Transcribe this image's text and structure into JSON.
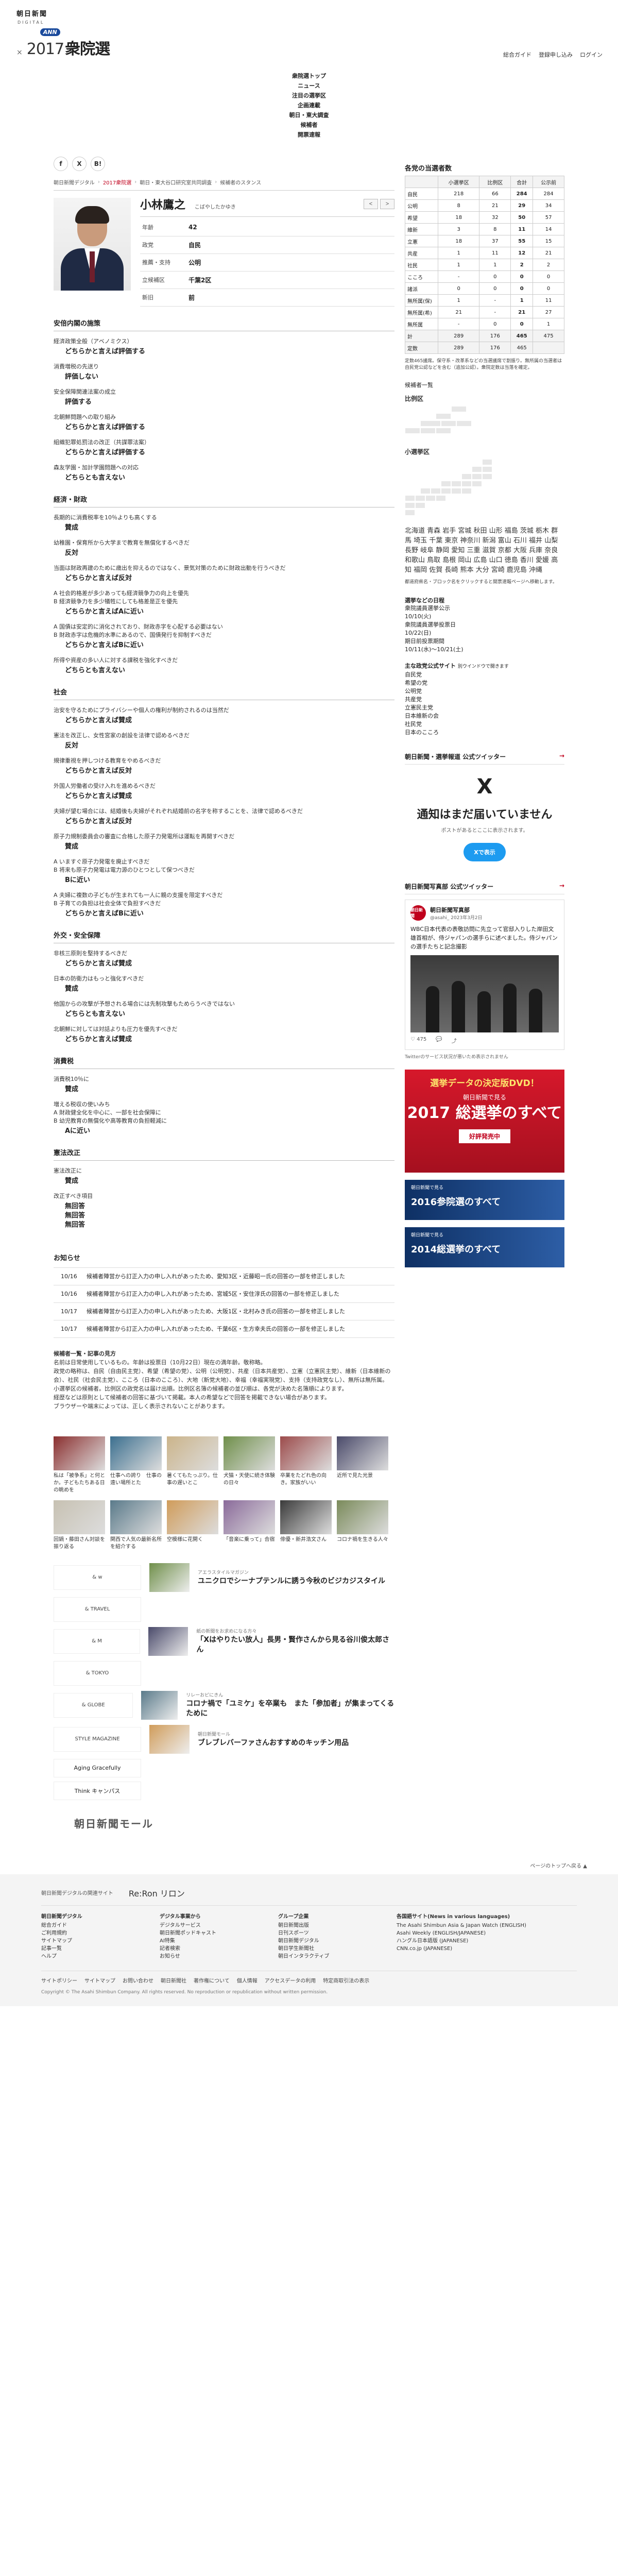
{
  "header": {
    "brand": "朝日新聞",
    "brand_sub": "DIGITAL",
    "cross": "×",
    "ann": "ANN",
    "election_year": "2017",
    "election_name": "衆院選",
    "util": [
      "総合ガイド",
      "登録申し込み",
      "ログイン"
    ]
  },
  "nav": [
    "衆院選トップ",
    "ニュース",
    "注目の選挙区",
    "企画連載",
    "朝日・東大調査",
    "候補者",
    "開票速報"
  ],
  "share": [
    "f",
    "X",
    "B!"
  ],
  "breadcrumb": [
    "朝日新聞デジタル",
    "2017衆院選",
    "朝日・東大谷口研究室共同調査",
    "候補者のスタンス"
  ],
  "profile": {
    "name": "小林鷹之",
    "kana": "こばやしたかゆき",
    "prev": "<",
    "next": ">",
    "rows": [
      {
        "k": "年齢",
        "v": "42"
      },
      {
        "k": "政党",
        "v": "自民"
      },
      {
        "k": "推薦・支持",
        "v": "公明"
      },
      {
        "k": "立候補区",
        "v": "千葉2区"
      },
      {
        "k": "新旧",
        "v": "前"
      }
    ]
  },
  "sections": [
    {
      "title": "安倍内閣の施策",
      "items": [
        {
          "q": "経済政策全般（アベノミクス）",
          "a": "どちらかと言えば評価する"
        },
        {
          "q": "消費増税の先送り",
          "a": "評価しない"
        },
        {
          "q": "安全保障関連法案の成立",
          "a": "評価する"
        },
        {
          "q": "北朝鮮問題への取り組み",
          "a": "どちらかと言えば評価する"
        },
        {
          "q": "組織犯罪処罰法の改正（共謀罪法案）",
          "a": "どちらかと言えば評価する"
        },
        {
          "q": "森友学園・加計学園問題への対応",
          "a": "どちらとも言えない"
        }
      ]
    },
    {
      "title": "経済・財政",
      "items": [
        {
          "q": "長期的に消費税率を10％よりも高くする",
          "a": "賛成"
        },
        {
          "q": "幼稚園・保育所から大学まで教育を無償化するべきだ",
          "a": "反対"
        },
        {
          "q": "当面は財政再建のために歳出を抑えるのではなく、景気対策のために財政出動を行うべきだ",
          "a": "どちらかと言えば反対"
        },
        {
          "q": "A 社会的格差が多少あっても経済競争力の向上を優先\nB 経済競争力を多少犠牲にしても格差是正を優先",
          "a": "どちらかと言えばAに近い"
        },
        {
          "q": "A 国債は安定的に消化されており、財政赤字を心配する必要はない\nB 財政赤字は危機的水準にあるので、国債発行を抑制すべきだ",
          "a": "どちらかと言えばBに近い"
        },
        {
          "q": "所得や資産の多い人に対する課税を強化すべきだ",
          "a": "どちらとも言えない"
        }
      ]
    },
    {
      "title": "社会",
      "items": [
        {
          "q": "治安を守るためにプライバシーや個人の権利が制約されるのは当然だ",
          "a": "どちらかと言えば賛成"
        },
        {
          "q": "憲法を改正し、女性宮家の創設を法律で認めるべきだ",
          "a": "反対"
        },
        {
          "q": "規律重視を押しつける教育をやめるべきだ",
          "a": "どちらかと言えば反対"
        },
        {
          "q": "外国人労働者の受け入れを進めるべきだ",
          "a": "どちらかと言えば賛成"
        },
        {
          "q": "夫婦が望む場合には、結婚後も夫婦がそれぞれ結婚前の名字を称することを、法律で認めるべきだ",
          "a": "どちらかと言えば反対"
        },
        {
          "q": "原子力規制委員会の審査に合格した原子力発電所は運転を再開すべきだ",
          "a": "賛成"
        },
        {
          "q": "A いますぐ原子力発電を廃止すべきだ\nB 将来も原子力発電は電力源のひとつとして保つべきだ",
          "a": "Bに近い"
        },
        {
          "q": "A 夫婦に複数の子どもが生まれても一人に親の支援を限定すべきだ\nB 子育ての負担は社会全体で負担すべきだ",
          "a": "どちらかと言えばBに近い"
        }
      ]
    },
    {
      "title": "外交・安全保障",
      "items": [
        {
          "q": "非核三原則を堅持するべきだ",
          "a": "どちらかと言えば賛成"
        },
        {
          "q": "日本の防衛力はもっと強化すべきだ",
          "a": "賛成"
        },
        {
          "q": "他国からの攻撃が予想される場合には先制攻撃もためらうべきではない",
          "a": "どちらとも言えない"
        },
        {
          "q": "北朝鮮に対しては対話よりも圧力を優先すべきだ",
          "a": "どちらかと言えば賛成"
        }
      ]
    },
    {
      "title": "消費税",
      "items": [
        {
          "q": "消費税10％に",
          "a": "賛成"
        },
        {
          "q": "増える税収の使いみち\nA 財政健全化を中心に、一部を社会保障に\nB 幼児教育の無償化や高等教育の負担軽減に",
          "a": "Aに近い"
        }
      ]
    },
    {
      "title": "憲法改正",
      "items": [
        {
          "q": "憲法改正に",
          "a": "賛成"
        },
        {
          "q": "改正すべき項目",
          "a": "無回答\n無回答\n無回答"
        }
      ]
    }
  ],
  "notice": {
    "title": "お知らせ",
    "items": [
      {
        "date": "10/16",
        "text": "候補者陣営から訂正入力の申し入れがあったため、愛知3区・近藤昭一氏の回答の一部を修正しました"
      },
      {
        "date": "10/16",
        "text": "候補者陣営から訂正入力の申し入れがあったため、宮城5区・安住淳氏の回答の一部を修正しました"
      },
      {
        "date": "10/17",
        "text": "候補者陣営から訂正入力の申し入れがあったため、大阪1区・北村みき氏の回答の一部を修正しました"
      },
      {
        "date": "10/17",
        "text": "候補者陣営から訂正入力の申し入れがあったため、千葉6区・生方幸夫氏の回答の一部を修正しました"
      }
    ]
  },
  "notes": [
    "候補者一覧・記事の見方",
    "名前は日常使用しているもの。年齢は投票日（10月22日）現在の満年齢。敬称略。",
    "政党の略称は、自民（自由民主党）、希望（希望の党）、公明（公明党）、共産（日本共産党）、立憲（立憲民主党）、維新（日本維新の会）、社民（社会民主党）、こころ（日本のこころ）、大地（新党大地）、幸福（幸福実現党）、支持（支持政党なし）、無所は無所属。",
    "小選挙区の候補者。比例区の政党名は届け出順。比例区名簿の候補者の並び順は、各党が決めた名簿順によります。",
    "経歴などは原則として候補者の回答に基づいて掲載。本人の希望などで回答を掲載できない場合があります。",
    "ブラウザーや端末によっては、正しく表示されないことがあります。"
  ],
  "thumbs": [
    {
      "cap": "私は「被争系」と何とか。子どもたちある日の眺めを"
    },
    {
      "cap": "仕事への誇り　仕事の遠い場所とた"
    },
    {
      "cap": "暑くてもたっぷり。仕事の遅いとこ"
    },
    {
      "cap": "犬猫・天使に続き体験の日々"
    },
    {
      "cap": "卒業をたどれ色の向き。家族がいい"
    },
    {
      "cap": "近所で見た光景"
    },
    {
      "cap": "回鍋・藤田さん対談を振り返る"
    },
    {
      "cap": "関西で人気の最新名所を紹介する"
    },
    {
      "cap": "空模様に花開く"
    },
    {
      "cap": "「音楽に乗って」合宿"
    },
    {
      "cap": "俳優・新井浩文さん"
    },
    {
      "cap": "コロナ禍を生きる人々"
    }
  ],
  "promos": [
    {
      "logo": "& w",
      "src": "アエラスタイルマガジン",
      "title": "ユニクロでシーナプテンルに誘う今秋のビジカジスタイル"
    },
    {
      "logo": "& TRAVEL",
      "src": "",
      "title": ""
    },
    {
      "logo": "& M",
      "src": "紙の新聞をお求めになる方々",
      "title": "「Xはやりたい放人」長男・賢作さんから見る谷川俊太郎さん"
    },
    {
      "logo": "& TOKYO",
      "src": "",
      "title": ""
    },
    {
      "logo": "& GLOBE",
      "src": "リレーおピにきん",
      "title": "コロナ禍で「ユミケ」を卒業も　また「参加者」が集まってくるために"
    },
    {
      "logo": "STYLE MAGAZINE",
      "src": "朝日新聞モール",
      "title": "ブレブレバーファさんおすすめのキッチン用品"
    }
  ],
  "extra_logos": [
    "Aging Gracefully",
    "Think キャンパス"
  ],
  "mall": "朝日新聞モール",
  "right": {
    "party_title": "各党の当選者数",
    "party_headers": [
      "",
      "小選挙区",
      "比例区",
      "合計",
      "公示前"
    ],
    "parties": [
      [
        "自民",
        "218",
        "66",
        "284",
        "284"
      ],
      [
        "公明",
        "8",
        "21",
        "29",
        "34"
      ],
      [
        "希望",
        "18",
        "32",
        "50",
        "57"
      ],
      [
        "維新",
        "3",
        "8",
        "11",
        "14"
      ],
      [
        "立憲",
        "18",
        "37",
        "55",
        "15"
      ],
      [
        "共産",
        "1",
        "11",
        "12",
        "21"
      ],
      [
        "社民",
        "1",
        "1",
        "2",
        "2"
      ],
      [
        "こころ",
        "-",
        "0",
        "0",
        "0"
      ],
      [
        "諸派",
        "0",
        "0",
        "0",
        "0"
      ],
      [
        "無所属(保)",
        "1",
        "-",
        "1",
        "11"
      ],
      [
        "無所属(希)",
        "21",
        "-",
        "21",
        "27"
      ],
      [
        "無所属",
        "-",
        "0",
        "0",
        "1"
      ],
      [
        "計",
        "289",
        "176",
        "465",
        "475"
      ]
    ],
    "party_total": [
      "定数",
      "289",
      "176",
      "465"
    ],
    "party_note": "定数465議席。保守系・改革系などの当選議席で割振り。無所属の当選者は自民党公認などを含む（追加公認）。衆院定数は当落を確定。",
    "map_title": "候補者一覧",
    "map_sub1": "比例区",
    "map_sub2": "小選挙区",
    "prefs": "北海道 青森 岩手 宮城 秋田 山形 福島 茨城 栃木 群馬 埼玉 千葉 東京 神奈川 新潟 富山 石川 福井 山梨 長野 岐阜 静岡 愛知 三重 滋賀 京都 大阪 兵庫 奈良 和歌山 鳥取 島根 岡山 広島 山口 徳島 香川 愛媛 高知 福岡 佐賀 長崎 熊本 大分 宮崎 鹿児島 沖縄",
    "pref_note": "都道府県名・ブロック名をクリックすると開票速報ページへ移動します。",
    "sched_title": "選挙などの日程",
    "sched": [
      "衆院議員選挙公示",
      "10/10(火)",
      "衆院議員選挙投票日",
      "10/22(日)",
      "期日前投票期間",
      "10/11(水)〜10/21(土)"
    ],
    "sites_title": "主な政党公式サイト",
    "sites_small": "別ウインドウで開きます",
    "sites": [
      "自民党",
      "希望の党",
      "公明党",
      "共産党",
      "立憲民主党",
      "日本維新の会",
      "社民党",
      "日本のこころ"
    ],
    "tw1_title": "朝日新聞・選挙報道 公式ツイッター",
    "tw_arrow": "→",
    "x_logo": "X",
    "x_msg": "通知はまだ届いていません",
    "x_sub": "ポストがあるとここに表示されます。",
    "x_btn": "Xで表示",
    "tw2_title": "朝日新聞写真部 公式ツイッター",
    "tweet_name": "朝日新聞写真部",
    "tweet_handle": "@asahi_ 2023年3月2日",
    "tweet_avatar": "朝日新聞",
    "tweet_body": "WBC日本代表の表敬訪問に先立って官邸入りした岸田文雄首相が、侍ジャパンの選手らに述べました。侍ジャパンの選手たちと記念撮影",
    "tweet_actions": [
      "♡ 475",
      "💬",
      "⤴"
    ],
    "x_foot": "Twitterのサービス状況が悪いため表示されません",
    "dvd_top": "選挙データの決定版DVD！",
    "dvd_mid": "朝日新聞で見る",
    "dvd_big": "2017 総選挙のすべて",
    "dvd_btn": "好評発売中",
    "b2_s1": "朝日新聞で見る",
    "b2_s2": "2016参院選のすべて",
    "b3_s1": "朝日新聞で見る",
    "b3_s2": "2014総選挙のすべて"
  },
  "back_top": "ページのトップへ戻る ▲",
  "footer": {
    "site_label": "朝日新聞デジタルの関連サイト",
    "reron": "Re:Ron リロン",
    "cols": [
      {
        "h": "朝日新聞デジタル",
        "lines": [
          "総合ガイド",
          "ご利用規約",
          "サイトマップ",
          "記事一覧",
          "ヘルプ"
        ]
      },
      {
        "h": "デジタル事業から",
        "lines": [
          "デジタルサービス",
          "朝日新聞ポッドキャスト",
          "AI特集",
          "記者検索",
          "お知らせ"
        ]
      },
      {
        "h": "グループ企業",
        "lines": [
          "朝日新聞出版",
          "日刊スポーツ",
          "朝日新聞デジタル",
          "朝日学生新聞社",
          "朝日インタラクティブ"
        ]
      },
      {
        "h": "各国語サイト(News in various languages)",
        "lines": [
          "The Asahi Shimbun Asia & Japan Watch (ENGLISH)",
          "Asahi Weekly (ENGLISH/JAPANESE)",
          "ハングル日本語版 (JAPANESE)",
          "CNN.co.jp (JAPANESE)"
        ]
      }
    ],
    "links": [
      "サイトポリシー",
      "サイトマップ",
      "お問い合わせ",
      "朝日新聞社",
      "著作権について",
      "個人情報",
      "アクセスデータの利用",
      "特定商取引法の表示"
    ],
    "copyright": "Copyright © The Asahi Shimbun Company. All rights reserved. No reproduction or republication without written permission."
  }
}
